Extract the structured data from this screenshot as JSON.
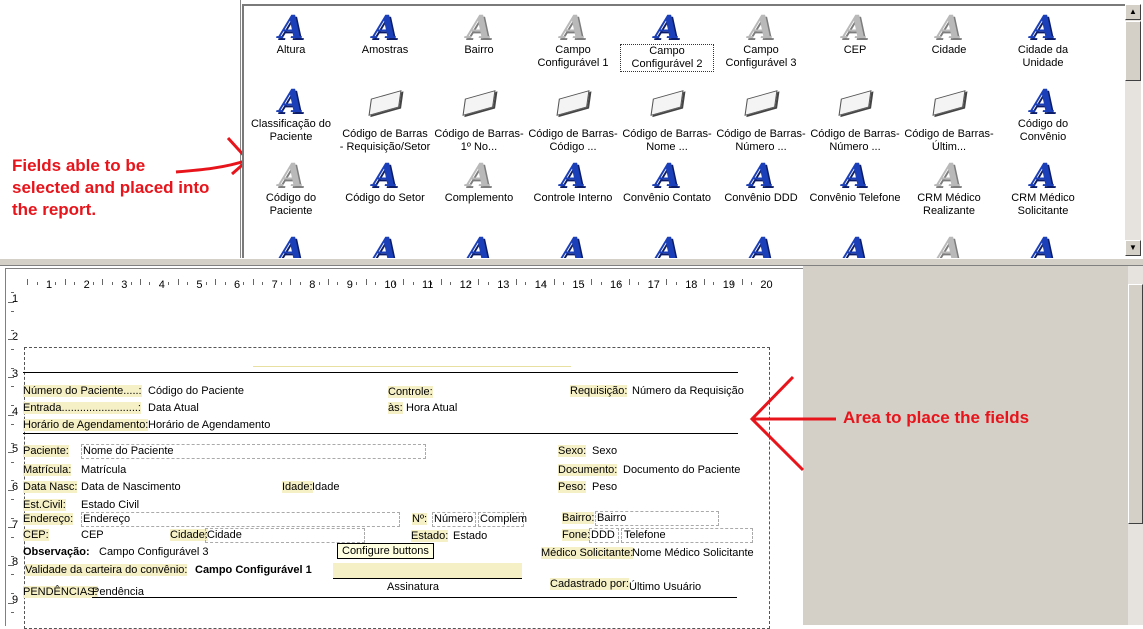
{
  "annotations": {
    "palette_note": "Fields able to be selected and placed into the report.",
    "area_note": "Area to place the fields",
    "colors": {
      "annotation": "#e8141b"
    }
  },
  "palette": {
    "items": [
      {
        "label": "Altura",
        "icon": "letter-a-icon"
      },
      {
        "label": "Amostras",
        "icon": "letter-a-icon"
      },
      {
        "label": "Bairro",
        "icon": "letter-a-gray-icon"
      },
      {
        "label": "Campo Configurável 1",
        "icon": "letter-a-gray-icon"
      },
      {
        "label": "Campo Configurável 2",
        "icon": "letter-a-icon",
        "selected": true
      },
      {
        "label": "Campo Configurável 3",
        "icon": "letter-a-gray-icon"
      },
      {
        "label": "CEP",
        "icon": "letter-a-gray-icon"
      },
      {
        "label": "Cidade",
        "icon": "letter-a-gray-icon"
      },
      {
        "label": "Cidade da Unidade",
        "icon": "letter-a-icon"
      },
      {
        "label": "Classificação do Paciente",
        "icon": "letter-a-icon"
      },
      {
        "label": "Código de Barras - Requisição/Setor",
        "icon": "barcode-icon"
      },
      {
        "label": "Código de Barras-1º No...",
        "icon": "barcode-icon"
      },
      {
        "label": "Código de Barras-Código ...",
        "icon": "barcode-icon"
      },
      {
        "label": "Código de Barras-Nome ...",
        "icon": "barcode-icon"
      },
      {
        "label": "Código de Barras-Número ...",
        "icon": "barcode-icon"
      },
      {
        "label": "Código de Barras-Número ...",
        "icon": "barcode-icon"
      },
      {
        "label": "Código de Barras-Últim...",
        "icon": "barcode-icon"
      },
      {
        "label": "Código do Convênio",
        "icon": "letter-a-icon"
      },
      {
        "label": "Código do Paciente",
        "icon": "letter-a-gray-icon"
      },
      {
        "label": "Código do Setor",
        "icon": "letter-a-icon"
      },
      {
        "label": "Complemento",
        "icon": "letter-a-gray-icon"
      },
      {
        "label": "Controle Interno",
        "icon": "letter-a-icon"
      },
      {
        "label": "Convênio Contato",
        "icon": "letter-a-icon"
      },
      {
        "label": "Convênio DDD",
        "icon": "letter-a-icon"
      },
      {
        "label": "Convênio Telefone",
        "icon": "letter-a-icon"
      },
      {
        "label": "CRM Médico Realizante",
        "icon": "letter-a-gray-icon"
      },
      {
        "label": "CRM Médico Solicitante",
        "icon": "letter-a-icon"
      }
    ]
  },
  "ruler": {
    "h": [
      "1",
      "2",
      "3",
      "4",
      "5",
      "6",
      "7",
      "8",
      "9",
      "10",
      "11",
      "12",
      "13",
      "14",
      "15",
      "16",
      "17",
      "18",
      "19",
      "20"
    ],
    "v": [
      "1",
      "2",
      "3",
      "4",
      "5",
      "6",
      "7",
      "8",
      "9"
    ]
  },
  "report": {
    "numero_label": "Número do Paciente.....:",
    "numero_value": "Código do Paciente",
    "controle_label": "Controle:",
    "requisicao_label": "Requisição:",
    "requisicao_value": "Número da Requisição",
    "entrada_label": "Entrada.........................:",
    "entrada_value": "Data Atual",
    "as_label": "às:",
    "as_value": "Hora Atual",
    "horario_label": "Horário de Agendamento:",
    "horario_value": "Horário de Agendamento",
    "paciente_label": "Paciente:",
    "paciente_value": "Nome do Paciente",
    "sexo_label": "Sexo:",
    "sexo_value": "Sexo",
    "matricula_label": "Matrícula:",
    "matricula_value": "Matrícula",
    "documento_label": "Documento:",
    "documento_value": "Documento do Paciente",
    "datanasc_label": "Data Nasc:",
    "datanasc_value": "Data de Nascimento",
    "idade_label": "Idade:",
    "idade_value": "Idade",
    "peso_label": "Peso:",
    "peso_value": "Peso",
    "estcivil_label": "Est.Civil:",
    "estcivil_value": "Estado Civil",
    "endereco_label": "Endereço:",
    "endereco_value": "Endereço",
    "num_label": "Nº:",
    "num_value": "Número",
    "complem_value": "Complem",
    "bairro_label": "Bairro:",
    "bairro_value": "Bairro",
    "cep_label": "CEP:",
    "cep_value": "CEP",
    "cidade_label": "Cidade:",
    "cidade_value": "Cidade",
    "estado_label": "Estado:",
    "estado_value": "Estado",
    "fone_label": "Fone:",
    "ddd_value": "DDD",
    "telefone_value": "Telefone",
    "observacao_label": "Observação:",
    "observacao_value": "Campo Configurável 3",
    "medico_label": "Médico Solicitante:",
    "medico_value": "Nome Médico Solicitante",
    "validade_label": "Validade da carteira do convênio:",
    "validade_value": "Campo Configurável 1",
    "assinatura": "Assinatura",
    "cadastrado_label": "Cadastrado por:",
    "cadastrado_value": "Último Usuário",
    "pendencias_label": "PENDÊNCIAS:",
    "pendencias_value": "Pendência"
  },
  "tooltip": "Configure buttons"
}
